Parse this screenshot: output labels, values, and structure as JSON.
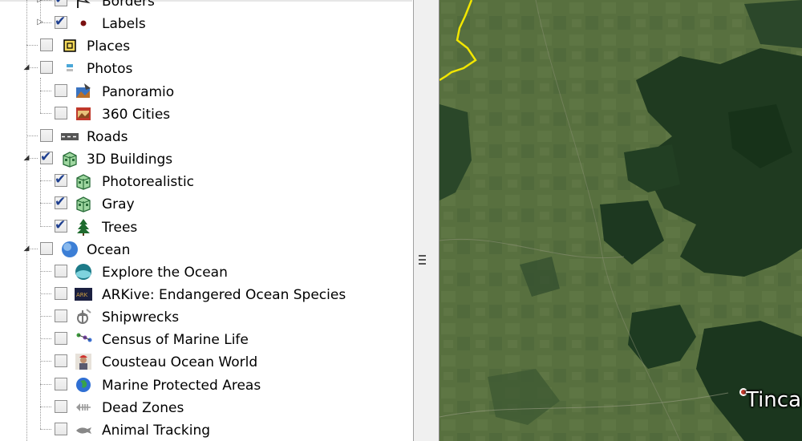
{
  "layers": [
    {
      "label": "Borders",
      "checked": true,
      "level": 1,
      "expander": "collapsed",
      "icon": "borders-flag-icon"
    },
    {
      "label": "Labels",
      "checked": true,
      "level": 1,
      "expander": "collapsed",
      "icon": "labels-dot-icon"
    },
    {
      "label": "Places",
      "checked": false,
      "level": 0,
      "expander": "none",
      "icon": "places-icon"
    },
    {
      "label": "Photos",
      "checked": false,
      "level": 0,
      "expander": "expanded",
      "icon": "photos-icon"
    },
    {
      "label": "Panoramio",
      "checked": false,
      "level": 1,
      "expander": "none",
      "icon": "panoramio-icon"
    },
    {
      "label": "360 Cities",
      "checked": false,
      "level": 1,
      "expander": "none",
      "icon": "360-cities-icon"
    },
    {
      "label": "Roads",
      "checked": false,
      "level": 0,
      "expander": "none",
      "icon": "roads-icon"
    },
    {
      "label": "3D Buildings",
      "checked": true,
      "level": 0,
      "expander": "expanded",
      "icon": "3d-buildings-icon"
    },
    {
      "label": "Photorealistic",
      "checked": true,
      "level": 1,
      "expander": "none",
      "icon": "building-icon"
    },
    {
      "label": "Gray",
      "checked": true,
      "level": 1,
      "expander": "none",
      "icon": "building-icon"
    },
    {
      "label": "Trees",
      "checked": true,
      "level": 1,
      "expander": "none",
      "icon": "tree-icon"
    },
    {
      "label": "Ocean",
      "checked": false,
      "level": 0,
      "expander": "expanded",
      "icon": "ocean-globe-icon"
    },
    {
      "label": "Explore the Ocean",
      "checked": false,
      "level": 1,
      "expander": "none",
      "icon": "explore-ocean-icon"
    },
    {
      "label": "ARKive: Endangered Ocean Species",
      "checked": false,
      "level": 1,
      "expander": "none",
      "icon": "arkive-icon"
    },
    {
      "label": "Shipwrecks",
      "checked": false,
      "level": 1,
      "expander": "none",
      "icon": "shipwreck-icon"
    },
    {
      "label": "Census of Marine Life",
      "checked": false,
      "level": 1,
      "expander": "none",
      "icon": "census-marine-icon"
    },
    {
      "label": "Cousteau Ocean World",
      "checked": false,
      "level": 1,
      "expander": "none",
      "icon": "cousteau-icon"
    },
    {
      "label": "Marine Protected Areas",
      "checked": false,
      "level": 1,
      "expander": "none",
      "icon": "marine-protected-icon"
    },
    {
      "label": "Dead Zones",
      "checked": false,
      "level": 1,
      "expander": "none",
      "icon": "dead-zones-icon"
    },
    {
      "label": "Animal Tracking",
      "checked": false,
      "level": 1,
      "expander": "none",
      "icon": "animal-tracking-icon"
    }
  ],
  "map": {
    "place_label": "Tinca",
    "border_color": "#f2e600"
  },
  "colors": {
    "check": "#1e3f8f",
    "map_light": "#5a7143",
    "map_dark": "#1f3a20"
  }
}
